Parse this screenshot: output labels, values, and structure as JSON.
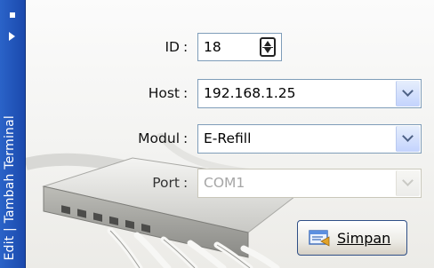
{
  "sidebar": {
    "title": "Edit | Tambah Terminal"
  },
  "form": {
    "id": {
      "label": "ID",
      "value": "18"
    },
    "host": {
      "label": "Host",
      "value": "192.168.1.25"
    },
    "modul": {
      "label": "Modul",
      "value": "E-Refill"
    },
    "port": {
      "label": "Port",
      "value": "COM1",
      "disabled": true
    },
    "colon": ":"
  },
  "actions": {
    "save_label": "Simpan"
  },
  "icons": {
    "pin": "pin-icon",
    "expand": "expand-arrow-icon",
    "spinner": "spinner-icon",
    "dropdown": "chevron-down-icon",
    "save": "save-icon"
  },
  "colors": {
    "strip": "#1b49ad",
    "field_border": "#7f9db9",
    "dropdown_button": "#c3d3fd"
  }
}
